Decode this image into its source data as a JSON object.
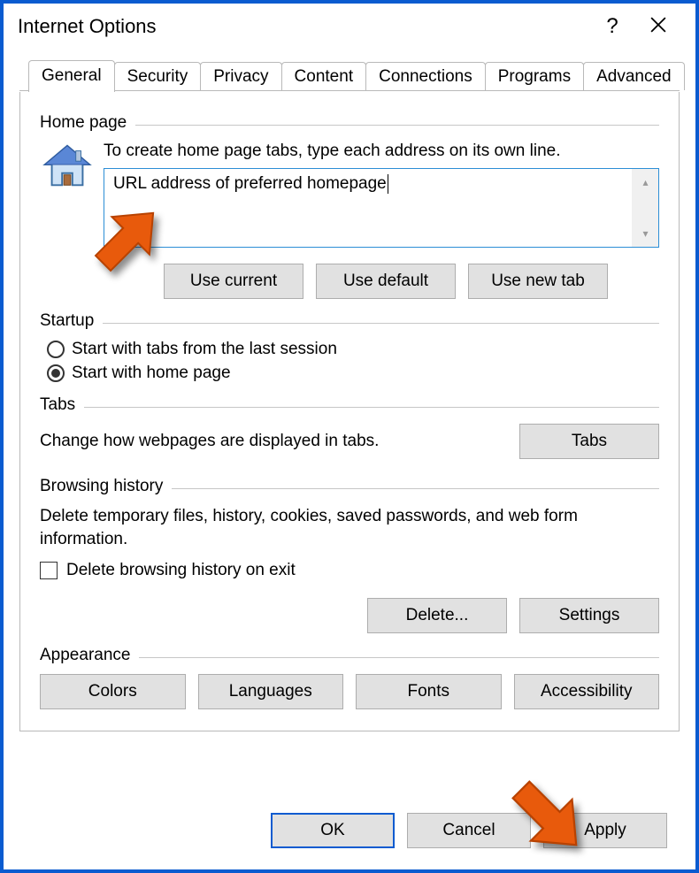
{
  "dialog": {
    "title": "Internet Options"
  },
  "tabs": {
    "general": "General",
    "security": "Security",
    "privacy": "Privacy",
    "content": "Content",
    "connections": "Connections",
    "programs": "Programs",
    "advanced": "Advanced"
  },
  "homepage": {
    "group_label": "Home page",
    "instruction": "To create home page tabs, type each address on its own line.",
    "value": "URL address of preferred homepage",
    "use_current": "Use current",
    "use_default": "Use default",
    "use_new_tab": "Use new tab"
  },
  "startup": {
    "group_label": "Startup",
    "opt_last_session": "Start with tabs from the last session",
    "opt_home_page": "Start with home page"
  },
  "tabs_section": {
    "group_label": "Tabs",
    "text": "Change how webpages are displayed in tabs.",
    "button": "Tabs"
  },
  "history": {
    "group_label": "Browsing history",
    "text": "Delete temporary files, history, cookies, saved passwords, and web form information.",
    "checkbox_label": "Delete browsing history on exit",
    "delete_button": "Delete...",
    "settings_button": "Settings"
  },
  "appearance": {
    "group_label": "Appearance",
    "colors": "Colors",
    "languages": "Languages",
    "fonts": "Fonts",
    "accessibility": "Accessibility"
  },
  "footer": {
    "ok": "OK",
    "cancel": "Cancel",
    "apply": "Apply"
  }
}
